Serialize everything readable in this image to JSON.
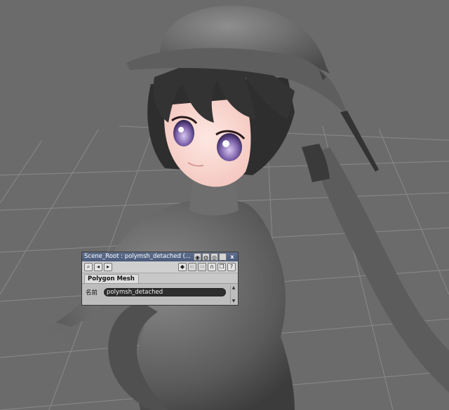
{
  "panel": {
    "title": "Scene_Root : polymsh_detached (...",
    "titlebar_icons": [
      "globe-icon",
      "lock-icon",
      "info-icon",
      "minimize-icon",
      "close-icon"
    ],
    "minimize_label": "_",
    "close_label": "x",
    "help_label": "?",
    "tab_label": "Polygon Mesh",
    "name_label": "名前",
    "name_value": "polymsh_detached"
  },
  "colors": {
    "viewport_bg": "#6b6b6b",
    "titlebar": "#4f5f80",
    "name_field_bg": "#2e2e2e"
  }
}
